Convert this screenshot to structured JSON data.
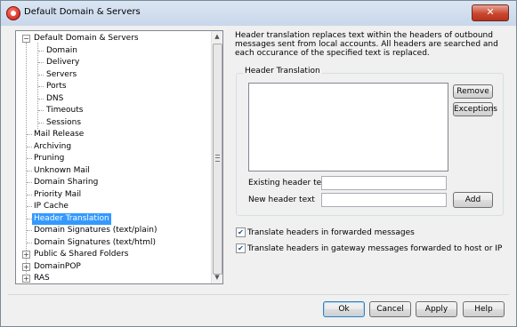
{
  "window": {
    "title": "Default Domain & Servers",
    "close": "✕"
  },
  "tree": {
    "items": [
      {
        "label": "Default Domain & Servers",
        "expander": "−"
      },
      {
        "label": "Domain"
      },
      {
        "label": "Delivery"
      },
      {
        "label": "Servers"
      },
      {
        "label": "Ports"
      },
      {
        "label": "DNS"
      },
      {
        "label": "Timeouts"
      },
      {
        "label": "Sessions"
      },
      {
        "label": "Mail Release"
      },
      {
        "label": "Archiving"
      },
      {
        "label": "Pruning"
      },
      {
        "label": "Unknown Mail"
      },
      {
        "label": "Domain Sharing"
      },
      {
        "label": "Priority Mail"
      },
      {
        "label": "IP Cache"
      },
      {
        "label": "Header Translation",
        "selected": true
      },
      {
        "label": "Domain Signatures (text/plain)"
      },
      {
        "label": "Domain Signatures (text/html)"
      },
      {
        "label": "Public & Shared Folders",
        "expander": "+"
      },
      {
        "label": "DomainPOP",
        "expander": "+"
      },
      {
        "label": "RAS",
        "expander": "+"
      }
    ],
    "scroll_up": "▲",
    "scroll_down": "▼"
  },
  "main": {
    "description": "Header translation replaces text within the headers of outbound messages sent from local accounts.  All headers are searched and each occurance of the specified text is replaced.",
    "group_label": "Header Translation",
    "remove_label": "Remove",
    "exceptions_label": "Exceptions",
    "existing_label": "Existing header text",
    "existing_value": "",
    "new_label": "New header text",
    "new_value": "",
    "add_label": "Add",
    "check1": {
      "label": "Translate headers in forwarded messages",
      "checked": true,
      "mark": "✔"
    },
    "check2": {
      "label": "Translate headers in gateway messages forwarded to host or IP",
      "checked": true,
      "mark": "✔"
    }
  },
  "footer": {
    "ok": "Ok",
    "cancel": "Cancel",
    "apply": "Apply",
    "help": "Help"
  },
  "colors": {
    "selection": "#3399ff",
    "close_button": "#c9472f"
  }
}
